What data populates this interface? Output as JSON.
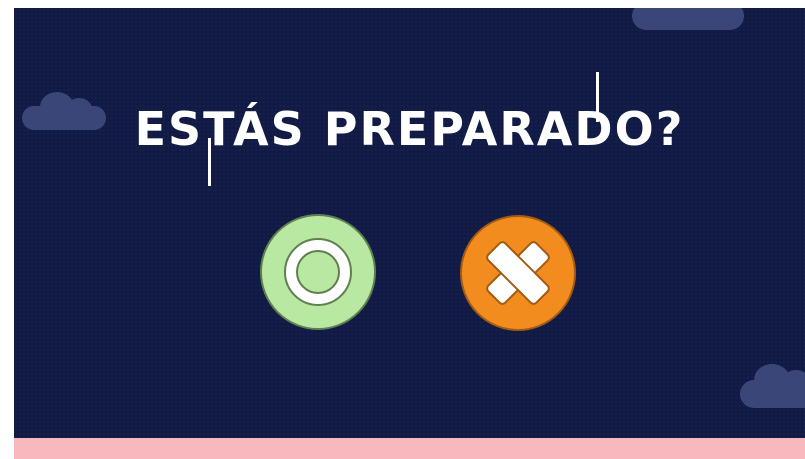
{
  "title": "ESTÁS PREPARADO?",
  "buttons": {
    "yes": {
      "icon": "circle-confirm-icon",
      "color": "#b9e8a3"
    },
    "no": {
      "icon": "x-cancel-icon",
      "color": "#f28c1e"
    }
  },
  "colors": {
    "background": "#101a45",
    "cloud": "#3a4677",
    "bottom_bar": "#f7b9bd"
  }
}
